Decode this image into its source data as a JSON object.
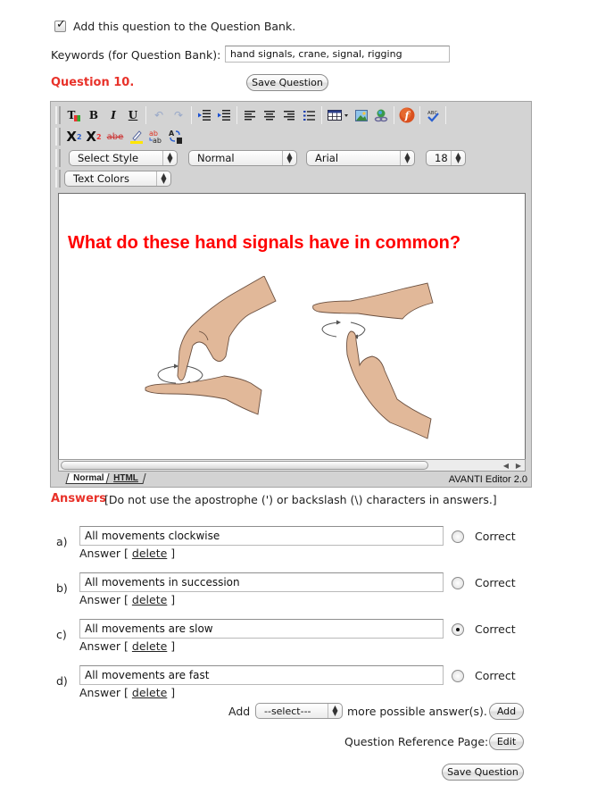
{
  "bank": {
    "checkbox_checked": true,
    "checkbox_label": "Add this question to the Question Bank.",
    "keywords_label": "Keywords (for Question Bank):",
    "keywords_value": "hand signals, crane, signal, rigging"
  },
  "question": {
    "label": "Question 10.",
    "save_label": "Save Question"
  },
  "editor": {
    "toolbar_row1": [
      {
        "name": "text-color-icon",
        "glyph": "T"
      },
      {
        "name": "bold-icon",
        "glyph": "B"
      },
      {
        "name": "italic-icon",
        "glyph": "I"
      },
      {
        "name": "underline-icon",
        "glyph": "U"
      },
      {
        "name": "undo-icon",
        "glyph": "↶"
      },
      {
        "name": "redo-icon",
        "glyph": "↷"
      },
      {
        "name": "outdent-icon",
        "glyph": "⇤"
      },
      {
        "name": "indent-icon",
        "glyph": "⇥"
      },
      {
        "name": "align-left-icon",
        "glyph": "≡"
      },
      {
        "name": "align-center-icon",
        "glyph": "≡"
      },
      {
        "name": "align-right-icon",
        "glyph": "≡"
      },
      {
        "name": "bullet-list-icon",
        "glyph": "☰"
      },
      {
        "name": "table-icon",
        "glyph": "▦"
      },
      {
        "name": "image-icon",
        "glyph": "🖼"
      },
      {
        "name": "link-icon",
        "glyph": "🔗"
      },
      {
        "name": "flash-icon",
        "glyph": "ƒ"
      },
      {
        "name": "spellcheck-icon",
        "glyph": "✓"
      }
    ],
    "toolbar_row2": [
      {
        "name": "subscript-icon",
        "glyph": "X₂"
      },
      {
        "name": "superscript-icon",
        "glyph": "X²"
      },
      {
        "name": "strikethrough-icon",
        "glyph": "abe"
      },
      {
        "name": "highlight-icon",
        "glyph": "✎"
      },
      {
        "name": "replace-icon",
        "glyph": "ab"
      },
      {
        "name": "find-replace-icon",
        "glyph": "A⇆"
      }
    ],
    "style_select": "Select Style",
    "format_select": "Normal",
    "font_select": "Arial",
    "size_select": "18",
    "text_colors_select": "Text Colors",
    "content_heading": "What do these hand signals have in common?",
    "tab_normal": "Normal",
    "tab_html": "HTML",
    "version": "AVANTI Editor 2.0",
    "colors": {
      "heading": "#ff0000",
      "skin": "#e1b899"
    }
  },
  "answers": {
    "label": "Answers",
    "note": "[Do not use the apostrophe (') or backslash (\\) characters in answers.]",
    "items": [
      {
        "letter": "a)",
        "value": "All movements clockwise",
        "correct": false
      },
      {
        "letter": "b)",
        "value": "All movements in succession",
        "correct": false
      },
      {
        "letter": "c)",
        "value": "All movements are slow",
        "correct": true
      },
      {
        "letter": "d)",
        "value": "All movements are fast",
        "correct": false
      }
    ],
    "correct_label": "Correct",
    "answer_word": "Answer",
    "open_bracket": "[",
    "delete_label": "delete",
    "close_bracket": "]"
  },
  "add_more": {
    "prefix": "Add",
    "select_value": "--select---",
    "suffix": "more possible answer(s).",
    "button": "Add"
  },
  "reference": {
    "label": "Question Reference Page:",
    "button": "Edit"
  },
  "footer": {
    "save_label": "Save Question"
  },
  "colors": {
    "accent_red": "#e8322a"
  }
}
